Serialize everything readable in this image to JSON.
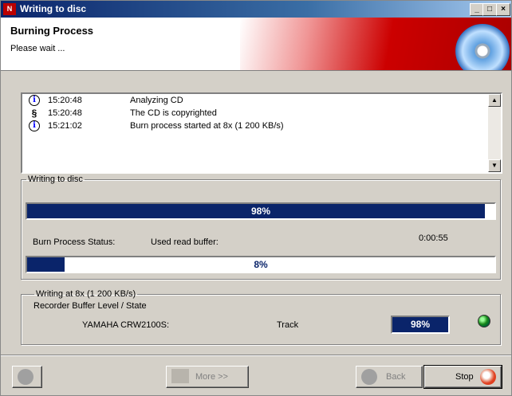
{
  "window": {
    "title": "Writing to disc",
    "controls": {
      "minimize": "_",
      "maximize": "□",
      "close": "×"
    }
  },
  "header": {
    "title": "Burning Process",
    "subtitle": "Please wait ..."
  },
  "log": {
    "entries": [
      {
        "icon": "info-icon",
        "time": "15:20:48",
        "message": "Analyzing CD"
      },
      {
        "icon": "copyright-icon",
        "time": "15:20:48",
        "message": "The CD is copyrighted"
      },
      {
        "icon": "info-icon",
        "time": "15:21:02",
        "message": "Burn process started at 8x (1 200 KB/s)"
      }
    ]
  },
  "writing_group": {
    "legend": "Writing to disc",
    "progress": {
      "label": "98%",
      "fraction": 0.98
    },
    "status_label": "Burn Process Status:",
    "buffer_label": "Used read buffer:",
    "elapsed": "0:00:55",
    "buffer": {
      "label": "8%",
      "fraction": 0.08
    }
  },
  "recorder_group": {
    "legend": "Writing at 8x (1 200 KB/s)",
    "subtitle": "Recorder Buffer Level / State",
    "drive": "YAMAHA CRW2100S:",
    "state": "Track",
    "level": "98%",
    "led_color": "#1a8a1a"
  },
  "buttons": {
    "more": "More >>",
    "back": "Back",
    "stop": "Stop"
  }
}
